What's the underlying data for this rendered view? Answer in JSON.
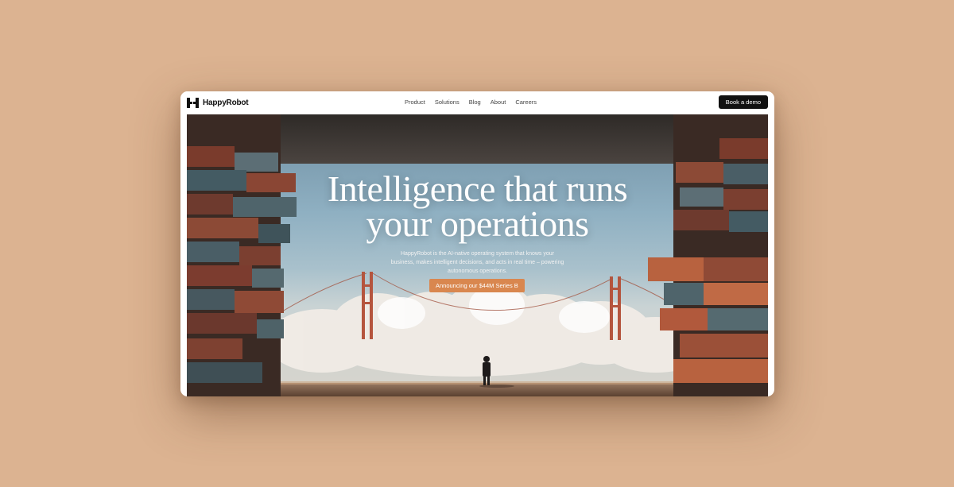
{
  "brand": {
    "name": "HappyRobot",
    "logo_icon": "happyrobot-logo-icon"
  },
  "nav": {
    "items": [
      {
        "label": "Product"
      },
      {
        "label": "Solutions"
      },
      {
        "label": "Blog"
      },
      {
        "label": "About"
      },
      {
        "label": "Careers"
      }
    ],
    "cta_label": "Book a demo"
  },
  "hero": {
    "headline_line1": "Intelligence that runs",
    "headline_line2": "your operations",
    "subtext": "HappyRobot is the AI-native operating system that knows your business, makes intelligent decisions, and acts in real time – powering autonomous operations.",
    "announcement_label": "Announcing our $44M Series B"
  },
  "colors": {
    "page_background": "#dcb391",
    "button_dark": "#111111",
    "announcement_accent": "#d9874f"
  }
}
